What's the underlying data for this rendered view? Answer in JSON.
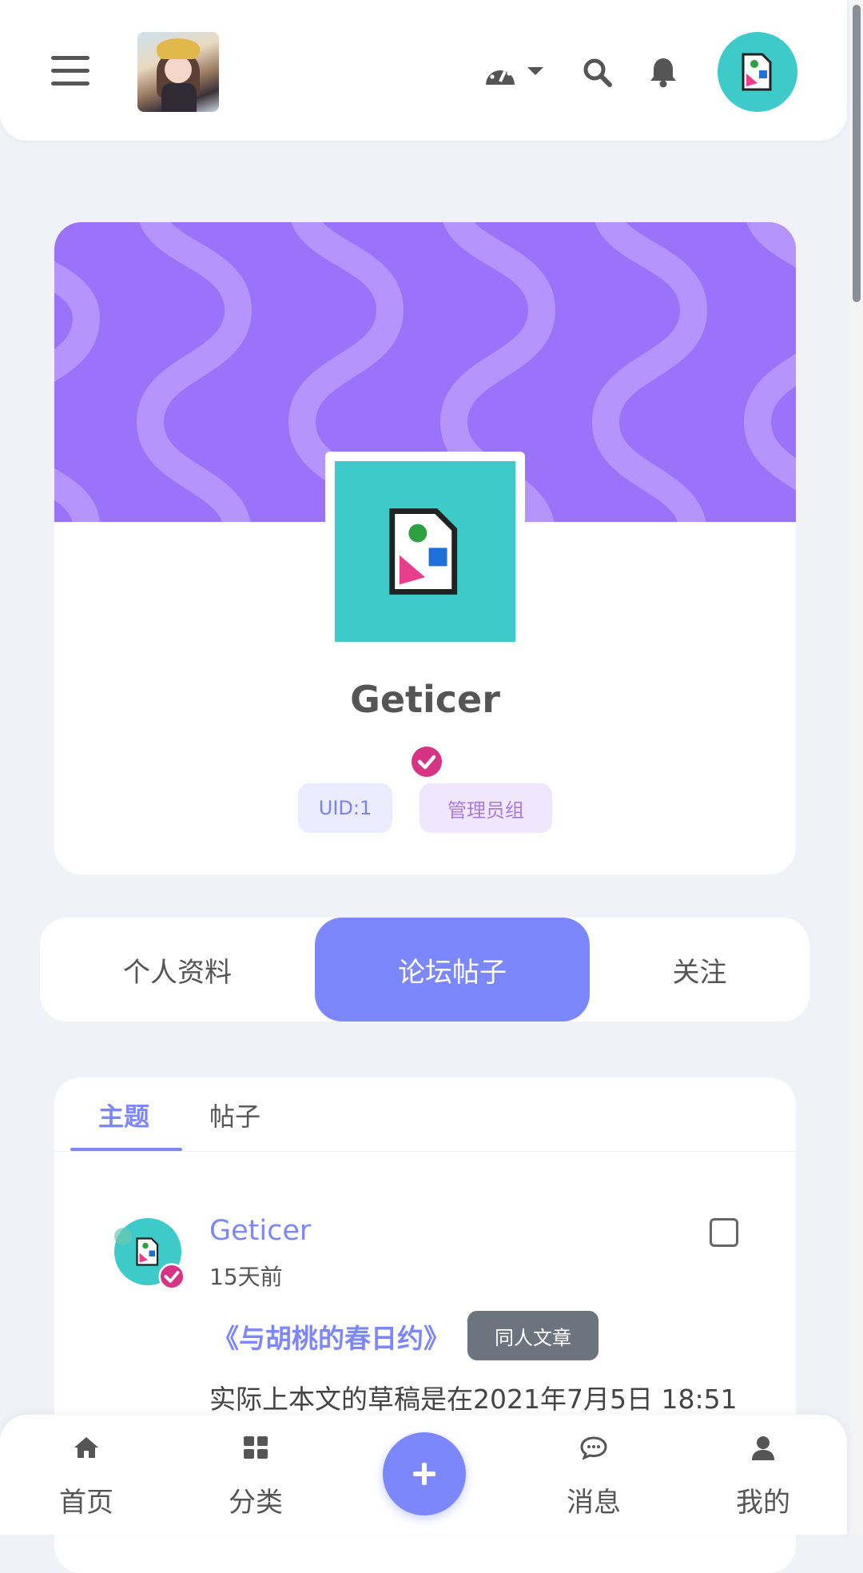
{
  "header": {
    "menu_icon": "hamburger-icon",
    "logo": "site-logo",
    "icons": [
      "dashboard-icon",
      "search-icon",
      "bell-icon"
    ],
    "avatar": "user-avatar"
  },
  "profile": {
    "username": "Geticer",
    "uid_badge": "UID:1",
    "group_badge": "管理员组",
    "banner_color": "#9b73fb",
    "avatar_color": "#3ecac9",
    "verified_color": "#d63384"
  },
  "tabs": [
    {
      "label": "个人资料",
      "active": false
    },
    {
      "label": "论坛帖子",
      "active": true
    },
    {
      "label": "关注",
      "active": false
    }
  ],
  "subtabs": [
    {
      "label": "主题",
      "active": true
    },
    {
      "label": "帖子",
      "active": false
    }
  ],
  "post": {
    "author": "Geticer",
    "time": "15天前",
    "title": "《与胡桃的春日约》",
    "tag": "同人文章",
    "excerpt": "实际上本文的草稿是在2021年7月5日 18:51"
  },
  "bottom_nav": [
    {
      "label": "首页",
      "icon": "home-icon"
    },
    {
      "label": "分类",
      "icon": "grid-icon"
    },
    {
      "label": "",
      "icon": "plus-icon"
    },
    {
      "label": "消息",
      "icon": "chat-icon"
    },
    {
      "label": "我的",
      "icon": "user-icon"
    }
  ],
  "colors": {
    "accent": "#7b87fb",
    "tag_bg": "#6c757d",
    "page_bg": "#f1f2f7"
  }
}
